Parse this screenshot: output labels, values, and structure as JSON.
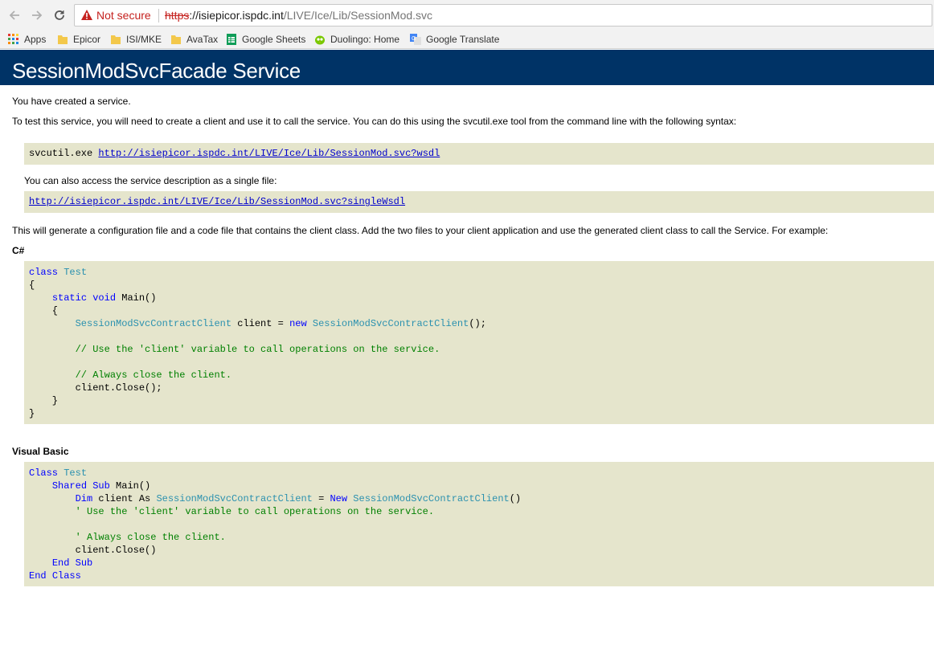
{
  "browser": {
    "security_label": "Not secure",
    "url_scheme": "https",
    "url_host": "://isiepicor.ispdc.int",
    "url_path": "/LIVE/Ice/Lib/SessionMod.svc",
    "bookmarks": [
      "Apps",
      "Epicor",
      "ISI/MKE",
      "AvaTax",
      "Google Sheets",
      "Duolingo: Home",
      "Google Translate"
    ]
  },
  "page": {
    "title": "SessionModSvcFacade Service",
    "intro": "You have created a service.",
    "instructions": "To test this service, you will need to create a client and use it to call the service. You can do this using the svcutil.exe tool from the command line with the following syntax:",
    "svcutil_cmd": "svcutil.exe ",
    "wsdl_link": "http://isiepicor.ispdc.int/LIVE/Ice/Lib/SessionMod.svc?wsdl",
    "single_file_text": "You can also access the service description as a single file:",
    "single_wsdl_link": "http://isiepicor.ispdc.int/LIVE/Ice/Lib/SessionMod.svc?singleWsdl",
    "generate_text": "This will generate a configuration file and a code file that contains the client class. Add the two files to your client application and use the generated client class to call the Service. For example:",
    "csharp_heading": "C#",
    "vb_heading": "Visual Basic"
  },
  "colors": {
    "banner": "#003366",
    "code_bg": "#e5e5cc",
    "keyword": "#0000ff",
    "type": "#2b91af",
    "comment": "#008000"
  },
  "csharp_code": [
    [
      {
        "t": "class",
        "c": "kw"
      },
      {
        "t": " "
      },
      {
        "t": "Test",
        "c": "ty"
      }
    ],
    [
      {
        "t": "{"
      }
    ],
    [
      {
        "t": "    "
      },
      {
        "t": "static",
        "c": "kw"
      },
      {
        "t": " "
      },
      {
        "t": "void",
        "c": "kw"
      },
      {
        "t": " Main()"
      }
    ],
    [
      {
        "t": "    {"
      }
    ],
    [
      {
        "t": "        "
      },
      {
        "t": "SessionModSvcContractClient",
        "c": "ty"
      },
      {
        "t": " client = "
      },
      {
        "t": "new",
        "c": "kw"
      },
      {
        "t": " "
      },
      {
        "t": "SessionModSvcContractClient",
        "c": "ty"
      },
      {
        "t": "();"
      }
    ],
    [
      {
        "t": ""
      }
    ],
    [
      {
        "t": "        "
      },
      {
        "t": "// Use the 'client' variable to call operations on the service.",
        "c": "cm"
      }
    ],
    [
      {
        "t": ""
      }
    ],
    [
      {
        "t": "        "
      },
      {
        "t": "// Always close the client.",
        "c": "cm"
      }
    ],
    [
      {
        "t": "        client.Close();"
      }
    ],
    [
      {
        "t": "    }"
      }
    ],
    [
      {
        "t": "}"
      }
    ]
  ],
  "vb_code": [
    [
      {
        "t": "Class",
        "c": "kw"
      },
      {
        "t": " "
      },
      {
        "t": "Test",
        "c": "ty"
      }
    ],
    [
      {
        "t": "    "
      },
      {
        "t": "Shared",
        "c": "kw"
      },
      {
        "t": " "
      },
      {
        "t": "Sub",
        "c": "kw"
      },
      {
        "t": " Main()"
      }
    ],
    [
      {
        "t": "        "
      },
      {
        "t": "Dim",
        "c": "kw"
      },
      {
        "t": " client As "
      },
      {
        "t": "SessionModSvcContractClient",
        "c": "ty"
      },
      {
        "t": " = "
      },
      {
        "t": "New",
        "c": "kw"
      },
      {
        "t": " "
      },
      {
        "t": "SessionModSvcContractClient",
        "c": "ty"
      },
      {
        "t": "()"
      }
    ],
    [
      {
        "t": "        "
      },
      {
        "t": "' Use the 'client' variable to call operations on the service.",
        "c": "cm"
      }
    ],
    [
      {
        "t": ""
      }
    ],
    [
      {
        "t": "        "
      },
      {
        "t": "' Always close the client.",
        "c": "cm"
      }
    ],
    [
      {
        "t": "        client.Close()"
      }
    ],
    [
      {
        "t": "    "
      },
      {
        "t": "End",
        "c": "kw"
      },
      {
        "t": " "
      },
      {
        "t": "Sub",
        "c": "kw"
      }
    ],
    [
      {
        "t": "End",
        "c": "kw"
      },
      {
        "t": " "
      },
      {
        "t": "Class",
        "c": "kw"
      }
    ]
  ]
}
